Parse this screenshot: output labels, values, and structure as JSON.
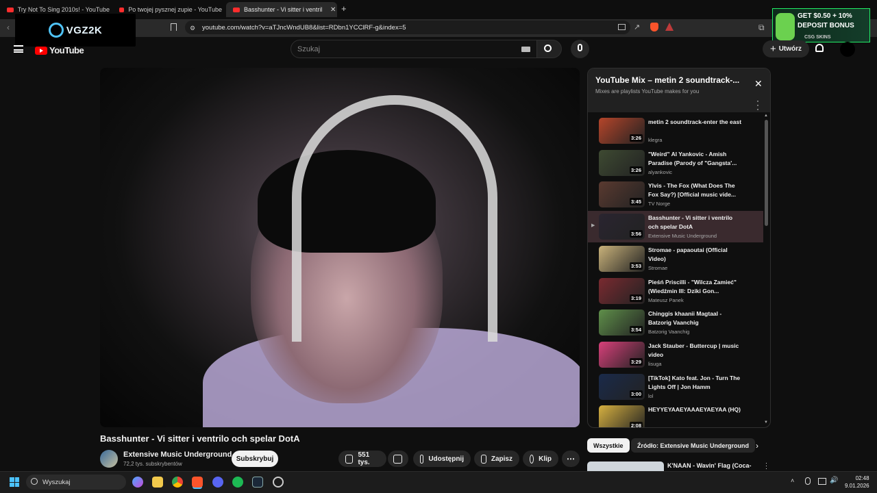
{
  "browser": {
    "tabs": [
      {
        "title": "Try Not To Sing 2010s! - YouTube"
      },
      {
        "title": "Po twojej pysznej zupie - YouTube"
      },
      {
        "title": "Basshunter - Vi sitter i ventril"
      }
    ],
    "url": "youtube.com/watch?v=aTJncWndUB8&list=RDbn1YCClRF-g&index=5"
  },
  "overlay_logo": "VGZ2K",
  "ad": {
    "line1": "GET $0.50 + 10%",
    "line2": "DEPOSIT BONUS",
    "brand": "CSG SKINS"
  },
  "header": {
    "logo_text": "YouTube",
    "search_placeholder": "Szukaj",
    "create_label": "Utwórz"
  },
  "video": {
    "title": "Basshunter - Vi sitter i ventrilo och spelar DotA",
    "channel": "Extensive Music Underground",
    "subscribers": "72,2 tys. subskrybentów",
    "subscribe_label": "Subskrybuj",
    "likes": "551 tys.",
    "share_label": "Udostępnij",
    "save_label": "Zapisz",
    "clip_label": "Klip"
  },
  "playlist": {
    "title": "YouTube Mix – metin 2 soundtrack-...",
    "subtitle": "Mixes are playlists YouTube makes for you",
    "items": [
      {
        "title": "metin 2 soundtrack-enter the east",
        "channel": "klegra",
        "duration": "3:26",
        "color": "#b5452a"
      },
      {
        "title": "\"Weird\" Al Yankovic - Amish Paradise (Parody of \"Gangsta'...",
        "channel": "alyankovic",
        "duration": "3:26",
        "color": "#3e4a32"
      },
      {
        "title": "Ylvis - The Fox (What Does The Fox Say?) [Official music vide...",
        "channel": "TV Norge",
        "duration": "3:45",
        "color": "#5a3a30"
      },
      {
        "title": "Basshunter - Vi sitter i ventrilo och spelar DotA",
        "channel": "Extensive Music Underground",
        "duration": "3:56",
        "color": "#2a2530"
      },
      {
        "title": "Stromae - papaoutai (Official Video)",
        "channel": "Stromae",
        "duration": "3:53",
        "color": "#c9b27a"
      },
      {
        "title": "Pieśń Priscilli - \"Wilcza Zamieć\" (Wiedźmin III: Dziki Gon...",
        "channel": "Mateusz Panek",
        "duration": "3:19",
        "color": "#7a2a30"
      },
      {
        "title": "Chinggis khaanii Magtaal - Batzorig Vaanchig",
        "channel": "Batzorig Vaanchig",
        "duration": "3:54",
        "color": "#5f8f4a"
      },
      {
        "title": "Jack Stauber - Buttercup | music video",
        "channel": "lisuga",
        "duration": "3:29",
        "color": "#d8407a"
      },
      {
        "title": "[TikTok] Kato feat. Jon - Turn The Lights Off | Jon Hamm",
        "channel": "lol",
        "duration": "3:00",
        "color": "#1a2a4a"
      },
      {
        "title": "HEYYEYAAEYAAAEYAEYAA (HQ)",
        "channel": "",
        "duration": "2:08",
        "color": "#d6b040"
      }
    ]
  },
  "chips": {
    "all": "Wszystkie",
    "source": "Źródło: Extensive Music Underground"
  },
  "recommendation": {
    "title": "K'NAAN - Wavin' Flag (Coca-"
  },
  "taskbar": {
    "search_placeholder": "Wyszukaj",
    "time": "02:48",
    "date": "9.01.2026"
  }
}
